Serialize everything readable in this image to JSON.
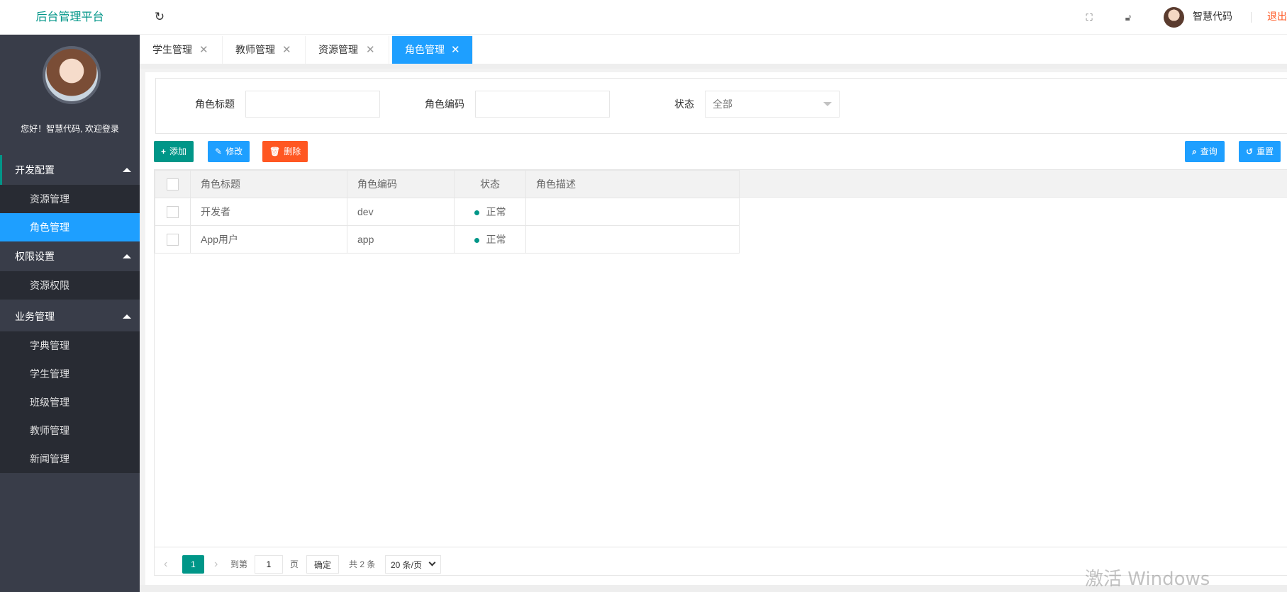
{
  "app": {
    "title": "后台管理平台"
  },
  "header": {
    "username": "智慧代码",
    "logout": "退出",
    "refresh_icon": "refresh-icon",
    "fullscreen_icon": "fullscreen-icon",
    "lock_icon": "lock-icon"
  },
  "sidebar": {
    "welcome": "您好！智慧代码, 欢迎登录",
    "groups": [
      {
        "label": "开发配置",
        "items": [
          "资源管理",
          "角色管理"
        ]
      },
      {
        "label": "权限设置",
        "items": [
          "资源权限"
        ]
      },
      {
        "label": "业务管理",
        "items": [
          "字典管理",
          "学生管理",
          "班级管理",
          "教师管理",
          "新闻管理"
        ]
      }
    ],
    "active_item": "角色管理"
  },
  "tabs": [
    {
      "label": "学生管理"
    },
    {
      "label": "教师管理"
    },
    {
      "label": "资源管理"
    },
    {
      "label": "角色管理",
      "active": true
    }
  ],
  "search": {
    "title_label": "角色标题",
    "code_label": "角色编码",
    "status_label": "状态",
    "status_value": "全部"
  },
  "toolbar": {
    "add": "添加",
    "edit": "修改",
    "delete": "删除",
    "query": "查询",
    "reset": "重置"
  },
  "table": {
    "headers": [
      "角色标题",
      "角色编码",
      "状态",
      "角色描述"
    ],
    "rows": [
      {
        "title": "开发者",
        "code": "dev",
        "status": "正常",
        "desc": ""
      },
      {
        "title": "App用户",
        "code": "app",
        "status": "正常",
        "desc": ""
      }
    ]
  },
  "pager": {
    "current": "1",
    "goto_label": "到第",
    "goto_value": "1",
    "page_label": "页",
    "confirm": "确定",
    "total": "共 2 条",
    "per_page": "20 条/页"
  },
  "watermark": "激活 Windows",
  "colors": {
    "primary": "#009688",
    "blue": "#1e9fff",
    "danger": "#ff5722",
    "sidebar": "#393d49"
  }
}
